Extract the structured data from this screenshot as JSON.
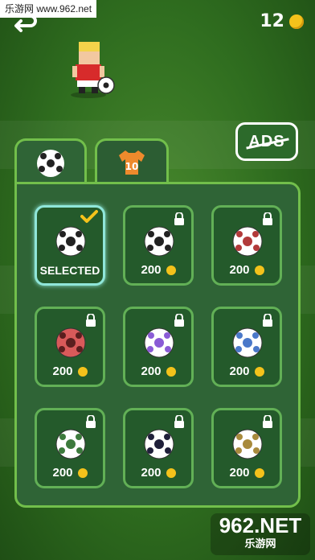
{
  "watermark": {
    "top_text": "乐游网 www.962.net",
    "bottom_big": "962.NET",
    "bottom_small": "乐游网"
  },
  "header": {
    "coins": "12"
  },
  "ads_label": "ADS",
  "tabs": [
    {
      "name": "balls",
      "active": true
    },
    {
      "name": "shirts",
      "active": false,
      "shirt_number": "10"
    }
  ],
  "grid": [
    {
      "label": "SELECTED",
      "selected": true,
      "locked": false,
      "ball": "classic"
    },
    {
      "price": "200",
      "selected": false,
      "locked": true,
      "ball": "telstar"
    },
    {
      "price": "200",
      "selected": false,
      "locked": true,
      "ball": "red-white"
    },
    {
      "price": "200",
      "selected": false,
      "locked": true,
      "ball": "red-hex"
    },
    {
      "price": "200",
      "selected": false,
      "locked": true,
      "ball": "purple-green"
    },
    {
      "price": "200",
      "selected": false,
      "locked": true,
      "ball": "blue-white"
    },
    {
      "price": "200",
      "selected": false,
      "locked": true,
      "ball": "green-white"
    },
    {
      "price": "200",
      "selected": false,
      "locked": true,
      "ball": "black-white"
    },
    {
      "price": "200",
      "selected": false,
      "locked": true,
      "ball": "gold-black"
    }
  ]
}
